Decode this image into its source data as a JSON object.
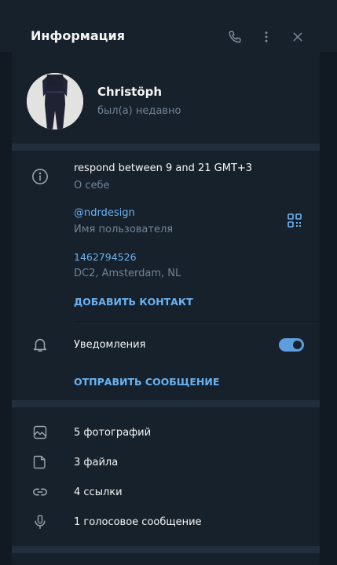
{
  "header": {
    "title": "Информация"
  },
  "profile": {
    "name": "Christöph",
    "status": "был(а) недавно"
  },
  "info": {
    "about_value": "respond between 9 and 21 GMT+3",
    "about_label": "О себе",
    "username_value": "@ndrdesign",
    "username_label": "Имя пользователя",
    "id_value": "1462794526",
    "dc_value": "DC2, Amsterdam, NL",
    "add_contact": "ДОБАВИТЬ КОНТАКТ"
  },
  "notifications": {
    "label": "Уведомления",
    "enabled": true
  },
  "send_message": "ОТПРАВИТЬ СООБЩЕНИЕ",
  "media": [
    {
      "label": "5 фотографий",
      "icon": "image-icon"
    },
    {
      "label": "3 файла",
      "icon": "file-icon"
    },
    {
      "label": "4 ссылки",
      "icon": "link-icon"
    },
    {
      "label": "1 голосовое сообщение",
      "icon": "microphone-icon"
    }
  ],
  "colors": {
    "panel": "#17212b",
    "separator": "#232e3c",
    "accent": "#6ab3f3",
    "text": "#f5f5f5",
    "muted": "#708499",
    "toggle": "#5e9ee0"
  }
}
